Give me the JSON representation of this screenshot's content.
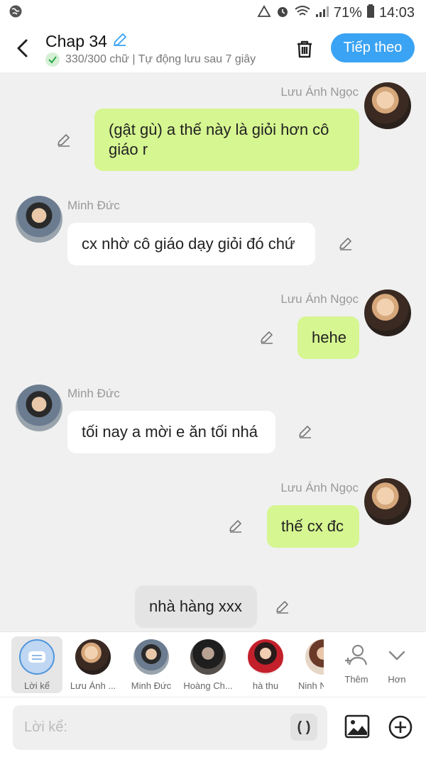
{
  "status_bar": {
    "battery": "71%",
    "time": "14:03"
  },
  "header": {
    "title": "Chap 34",
    "subtitle": "330/300 chữ | Tự động lưu sau 7 giây",
    "next_label": "Tiếp theo"
  },
  "messages": [
    {
      "sender": "Lưu Ánh Ngọc",
      "text": "(gật gù) a thế này là giỏi hơn cô giáo r",
      "side": "right"
    },
    {
      "sender": "Minh Đức",
      "text": "cx nhờ cô giáo dạy giỏi đó chứ",
      "side": "left"
    },
    {
      "sender": "Lưu Ánh Ngọc",
      "text": "hehe",
      "side": "right"
    },
    {
      "sender": "Minh Đức",
      "text": "tối nay a mời e ăn tối nhá",
      "side": "left"
    },
    {
      "sender": "Lưu Ánh Ngọc",
      "text": "thế cx đc",
      "side": "right"
    },
    {
      "sender": "",
      "text": "nhà hàng xxx",
      "side": "narration"
    }
  ],
  "characters": [
    {
      "name": "Lời kể"
    },
    {
      "name": "Lưu Ánh ..."
    },
    {
      "name": "Minh Đức"
    },
    {
      "name": "Hoàng Ch..."
    },
    {
      "name": "hà thu"
    },
    {
      "name": "Ninh N"
    }
  ],
  "actions": {
    "add_label": "Thêm",
    "more_label": "Hơn"
  },
  "input": {
    "placeholder": "Lời kể:",
    "paren_label": "( )"
  },
  "colors": {
    "accent": "#3aa3f3",
    "bubble_right": "#d6f691",
    "bubble_left": "#ffffff",
    "narration": "#e4e4e4"
  }
}
